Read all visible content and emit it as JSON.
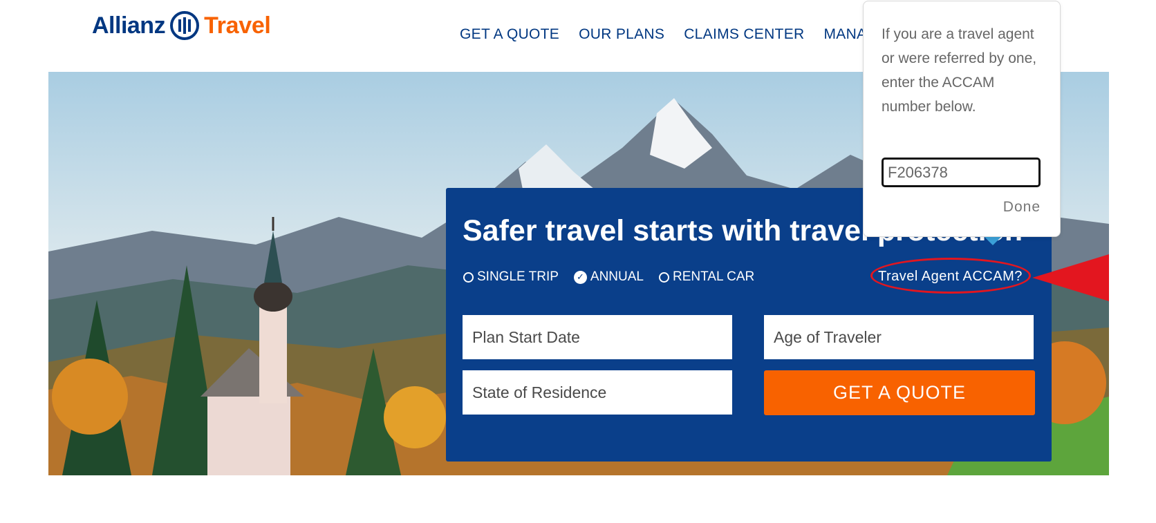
{
  "header": {
    "logo_brand": "Allianz",
    "logo_product": "Travel",
    "nav": [
      "GET A QUOTE",
      "OUR PLANS",
      "CLAIMS CENTER",
      "MANA"
    ]
  },
  "hero": {
    "headline": "Safer travel starts with travel protection",
    "options": [
      {
        "label": "SINGLE TRIP",
        "selected": false
      },
      {
        "label": "ANNUAL",
        "selected": true
      },
      {
        "label": "RENTAL CAR",
        "selected": false
      }
    ],
    "accam_link": "Travel Agent ACCAM?",
    "fields": {
      "plan_start_date": "Plan Start Date",
      "age_of_traveler": "Age of Traveler",
      "state_of_residence": "State of Residence"
    },
    "cta": "GET A QUOTE"
  },
  "popover": {
    "text": "If you are a travel agent or were referred by one, enter the ACCAM number below.",
    "accam_value": "F206378",
    "done_label": "Done"
  },
  "colors": {
    "brand_blue": "#003781",
    "panel_blue": "#0a3f8a",
    "orange": "#f86200",
    "annotation_red": "#e3161f"
  }
}
